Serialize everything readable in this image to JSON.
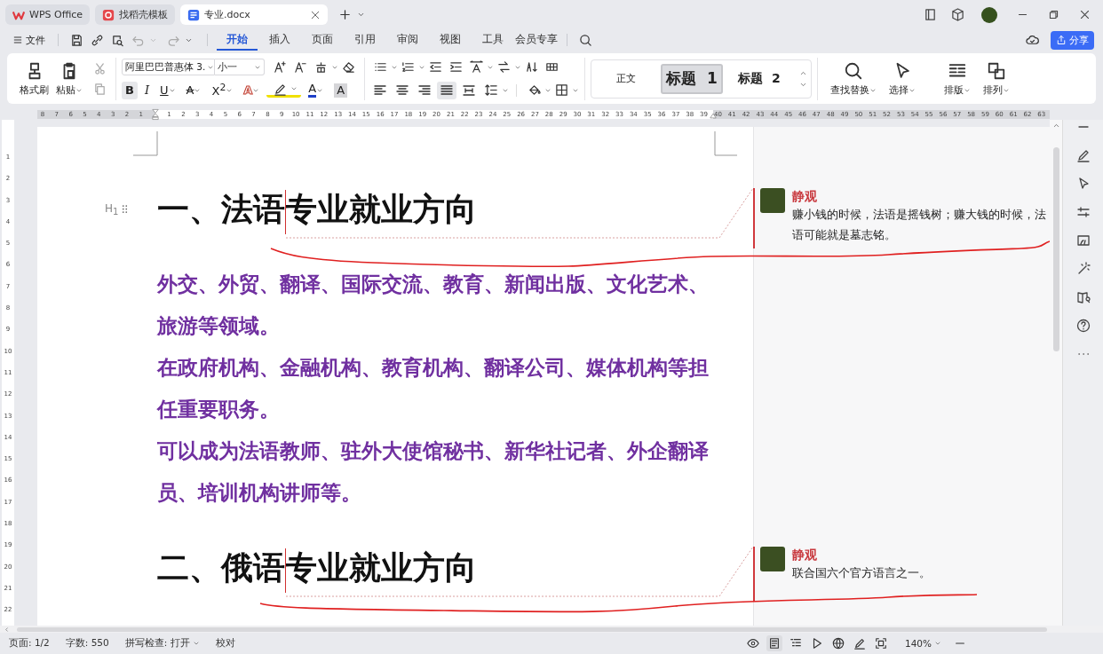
{
  "tabs": [
    {
      "label": "WPS Office",
      "selected": false
    },
    {
      "label": "找稻壳模板",
      "selected": false
    },
    {
      "label": "专业.docx",
      "selected": true
    }
  ],
  "file_menu": "文件",
  "menu_tabs": [
    {
      "label": "开始",
      "selected": true
    },
    {
      "label": "插入",
      "selected": false
    },
    {
      "label": "页面",
      "selected": false
    },
    {
      "label": "引用",
      "selected": false
    },
    {
      "label": "审阅",
      "selected": false
    },
    {
      "label": "视图",
      "selected": false
    },
    {
      "label": "工具",
      "selected": false
    },
    {
      "label": "会员专享",
      "selected": false
    }
  ],
  "share_button": "分享",
  "ribbon": {
    "clipboard": [
      {
        "label": "格式刷"
      },
      {
        "label": "粘贴"
      }
    ],
    "font_name": "阿里巴巴普惠体 3.",
    "font_size": "小一",
    "format": [
      {
        "kind": "bold",
        "glyph": "B",
        "selected": true
      },
      {
        "kind": "italic",
        "glyph": "I",
        "selected": false
      },
      {
        "kind": "underline",
        "glyph": "U",
        "selected": false
      },
      {
        "kind": "strike",
        "glyph": "A",
        "selected": false
      },
      {
        "kind": "superscript",
        "glyph": "X$^{2}$",
        "selected": false
      },
      {
        "kind": "outline",
        "glyph": "A",
        "selected": false
      },
      {
        "kind": "highlight",
        "selected": false
      },
      {
        "kind": "font_color",
        "glyph": "A",
        "selected": false
      },
      {
        "kind": "shading",
        "glyph": "A",
        "selected": false
      }
    ],
    "align": [
      {
        "selected": false
      },
      {
        "selected": false
      },
      {
        "selected": false
      },
      {
        "selected": true
      },
      {
        "selected": false
      }
    ],
    "styles": [
      {
        "label": "正文",
        "selected": false
      },
      {
        "label": "标题  1",
        "selected": true
      },
      {
        "label": "标题  2",
        "selected": false
      }
    ],
    "tools": [
      {
        "label": "查找替换"
      },
      {
        "label": "选择"
      },
      {
        "label": "排版"
      },
      {
        "label": "排列"
      }
    ]
  },
  "ruler": {
    "left_labels": [
      "8",
      "7",
      "6",
      "5",
      "4",
      "3",
      "2",
      "1"
    ],
    "labels": [
      "1",
      "2",
      "3",
      "4",
      "5",
      "6",
      "7",
      "8",
      "9",
      "10",
      "11",
      "12",
      "13",
      "14",
      "15",
      "16",
      "17",
      "18",
      "19",
      "20",
      "21",
      "22",
      "23",
      "24",
      "25",
      "26",
      "27",
      "28",
      "29",
      "30",
      "31",
      "32",
      "33",
      "34",
      "35",
      "36",
      "37",
      "38",
      "39",
      "40",
      "41",
      "42",
      "43",
      "44",
      "45",
      "46",
      "47",
      "48",
      "49",
      "50",
      "51",
      "52",
      "53",
      "54",
      "55",
      "56",
      "57",
      "58",
      "59",
      "60",
      "61",
      "62",
      "63"
    ]
  },
  "vertical_ruler": [
    "1",
    "2",
    "3",
    "4",
    "5",
    "6",
    "7",
    "8",
    "9",
    "10",
    "11",
    "12",
    "13",
    "14",
    "15",
    "16",
    "17",
    "18",
    "19",
    "20",
    "21",
    "22"
  ],
  "document": {
    "sections": [
      {
        "heading": "一、法语专业就业方向",
        "heading_label": "H$_{1}$",
        "paragraphs": [
          "外交、外贸、翻译、国际交流、教育、新闻出版、文化艺术、旅游等领域。",
          "在政府机构、金融机构、教育机构、翻译公司、媒体机构等担任重要职务。",
          "可以成为法语教师、驻外大使馆秘书、新华社记者、外企翻译员、培训机构讲师等。"
        ],
        "comment": {
          "author": "静观",
          "text": "赚小钱的时候，法语是摇钱树；赚大钱的时候，法语可能就是墓志铭。"
        }
      },
      {
        "heading": "二、俄语专业就业方向",
        "comment": {
          "author": "静观",
          "text": "联合国六个官方语言之一。"
        }
      }
    ]
  },
  "status_bar": {
    "page": "页面: 1/2",
    "words": "字数: 550",
    "spell_check": "拼写检查: 打开",
    "proofread": "校对",
    "zoom": "140%"
  }
}
